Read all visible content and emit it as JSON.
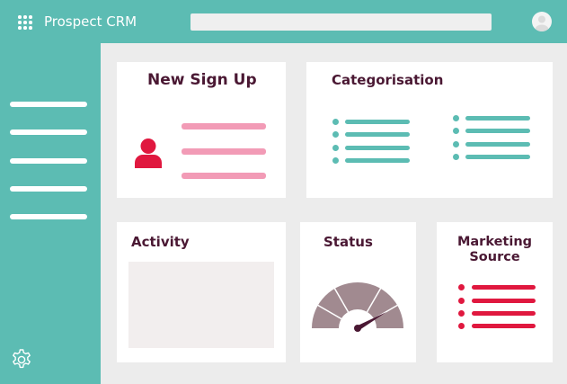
{
  "header": {
    "app_title": "Prospect CRM",
    "apps_icon": "grid-dots-icon",
    "avatar_icon": "user-avatar-icon"
  },
  "sidebar": {
    "nav_items": 5,
    "settings_icon": "gear-icon"
  },
  "cards": {
    "new_sign_up": {
      "title": "New Sign Up",
      "icon": "person-icon"
    },
    "categorisation": {
      "title": "Categorisation"
    },
    "activity": {
      "title": "Activity"
    },
    "status": {
      "title": "Status",
      "icon": "gauge-icon"
    },
    "marketing_source": {
      "title_line1": "Marketing",
      "title_line2": "Source"
    }
  },
  "colors": {
    "teal": "#5cbcb3",
    "plum": "#4a1833",
    "pink": "#f29bb6",
    "red": "#e0183f",
    "gauge": "#a18a90",
    "background": "#ececec"
  }
}
